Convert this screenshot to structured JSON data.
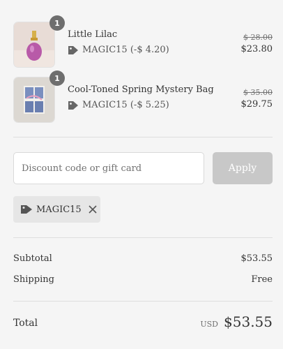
{
  "items": [
    {
      "quantity": "1",
      "name": "Little Lilac",
      "discount_code": "MAGIC15",
      "discount_amount": "(-$ 4.20)",
      "original_price": "$ 28.00",
      "price": "$23.80",
      "image": "perfume-bottle"
    },
    {
      "quantity": "1",
      "name": "Cool-Toned Spring Mystery Bag",
      "discount_code": "MAGIC15",
      "discount_amount": "(-$ 5.25)",
      "original_price": "$ 35.00",
      "price": "$29.75",
      "image": "cool-text-graphic"
    }
  ],
  "discount": {
    "placeholder": "Discount code or gift card",
    "apply_label": "Apply",
    "applied_code": "MAGIC15"
  },
  "summary": {
    "subtotal_label": "Subtotal",
    "subtotal_value": "$53.55",
    "shipping_label": "Shipping",
    "shipping_value": "Free",
    "total_label": "Total",
    "currency": "USD",
    "total_value": "$53.55"
  },
  "colors": {
    "background": "#f5f5f5",
    "badge": "#6e6e6e",
    "apply_disabled": "#c8c8c8",
    "tag_bg": "#e6e6e6"
  }
}
